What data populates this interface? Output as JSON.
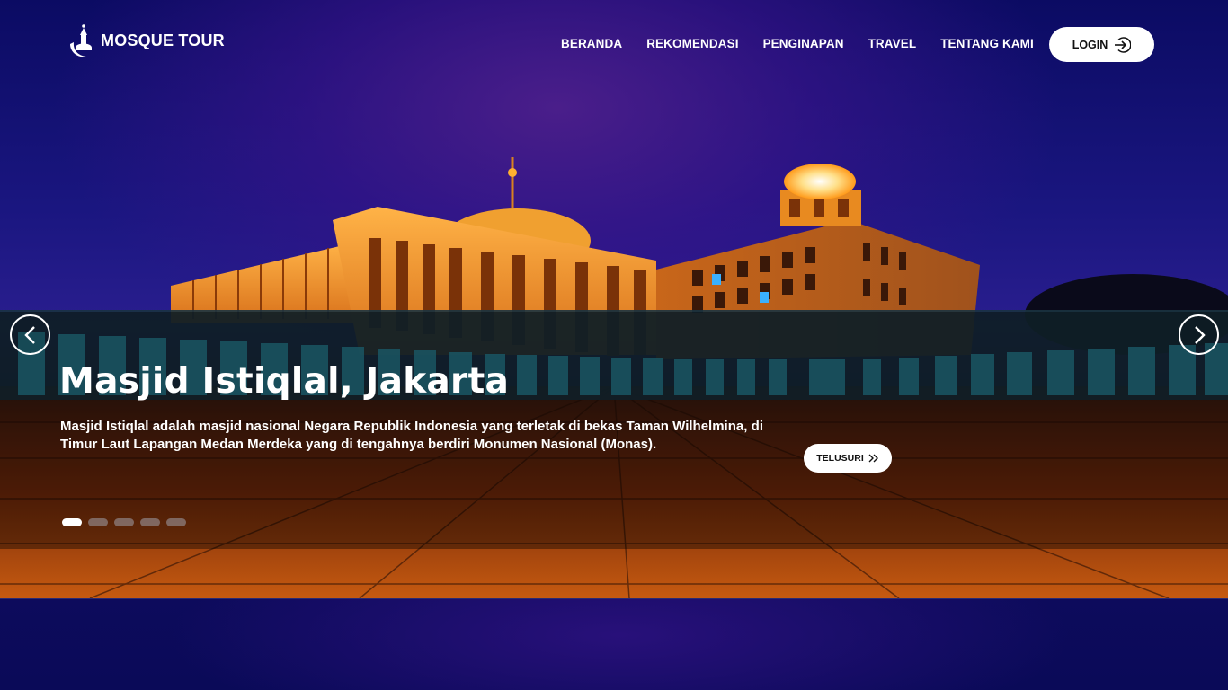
{
  "brand": {
    "name": "MOSQUE TOUR",
    "logo_icon": "mosque-logo-icon"
  },
  "nav": {
    "items": [
      {
        "label": "BERANDA"
      },
      {
        "label": "REKOMENDASI"
      },
      {
        "label": "PENGINAPAN"
      },
      {
        "label": "TRAVEL"
      },
      {
        "label": "TENTANG KAMI"
      }
    ],
    "login_label": "LOGIN",
    "login_icon": "login-arrow-icon"
  },
  "carousel": {
    "title": "Masjid Istiqlal, Jakarta",
    "description": "Masjid Istiqlal adalah masjid nasional Negara Republik Indonesia yang terletak di bekas Taman Wilhelmina, di Timur Laut Lapangan Medan Merdeka yang di tengahnya berdiri Monumen Nasional (Monas).",
    "button_label": "TELUSURI",
    "button_icon": "double-chevron-right-icon",
    "prev_icon": "chevron-left-icon",
    "next_icon": "chevron-right-icon",
    "slide_count": 5,
    "active_slide": 1
  },
  "colors": {
    "sky": "#1a1680",
    "building_glow": "#ff9a1a",
    "button_bg": "#ffffff"
  }
}
